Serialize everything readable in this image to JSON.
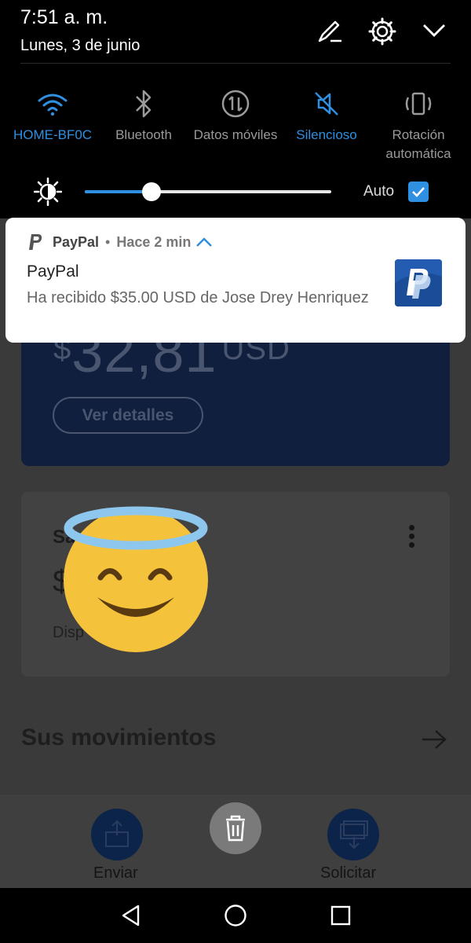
{
  "status": {
    "time": "7:51 a. m.",
    "date": "Lunes, 3 de junio"
  },
  "top_icons": [
    "edit-icon",
    "settings-icon",
    "collapse-chevron-icon"
  ],
  "quick_settings": [
    {
      "label": "HOME-BF0C",
      "icon": "wifi-icon",
      "active": true
    },
    {
      "label": "Bluetooth",
      "icon": "bluetooth-icon",
      "active": false
    },
    {
      "label": "Datos móviles",
      "icon": "mobile-data-icon",
      "active": false
    },
    {
      "label": "Silencioso",
      "icon": "silent-icon",
      "active": true
    },
    {
      "label_line1": "Rotación",
      "label_line2": "automática",
      "icon": "rotation-icon",
      "active": false
    }
  ],
  "brightness": {
    "level": 0.27,
    "auto_label": "Auto",
    "auto_checked": true
  },
  "notification": {
    "app": "PayPal",
    "separator": "•",
    "time": "Hace 2 min",
    "title": "PayPal",
    "body": "Ha recibido $35.00 USD de Jose Drey Henriquez"
  },
  "app_background": {
    "balance_currency": "$",
    "balance_amount": "32,81",
    "balance_unit": "USD",
    "details_button": "Ver detalles",
    "saldo_title": "Sa",
    "saldo_value": "$",
    "saldo_available": "Disp",
    "movements_title": "Sus movimientos",
    "send_label": "Enviar",
    "request_label": "Solicitar"
  },
  "colors": {
    "accent": "#2f8fe0",
    "paypal_navy": "#0f1f3d",
    "emoji_yellow": "#f5c33b",
    "halo_blue": "#8ec7ee"
  }
}
